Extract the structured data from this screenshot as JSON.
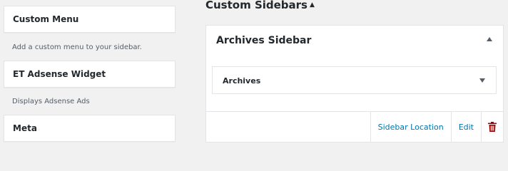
{
  "available_widgets": [
    {
      "title": "Custom Menu",
      "description": "Add a custom menu to your sidebar."
    },
    {
      "title": "ET Adsense Widget",
      "description": "Displays Adsense Ads"
    },
    {
      "title": "Meta"
    }
  ],
  "custom_sidebars": {
    "heading": "Custom Sidebars",
    "heading_icon": "triangle-up-down-icon",
    "sidebars": [
      {
        "title": "Archives Sidebar",
        "toggle_icon": "triangle-up-icon",
        "widgets": [
          {
            "title": "Archives",
            "toggle_icon": "triangle-down-icon"
          }
        ],
        "actions": {
          "location_label": "Sidebar Location",
          "edit_label": "Edit",
          "delete_icon": "trash-icon"
        }
      }
    ]
  },
  "colors": {
    "link": "#0073aa",
    "delete": "#a00000",
    "background": "#f1f1f1",
    "card": "#ffffff"
  }
}
